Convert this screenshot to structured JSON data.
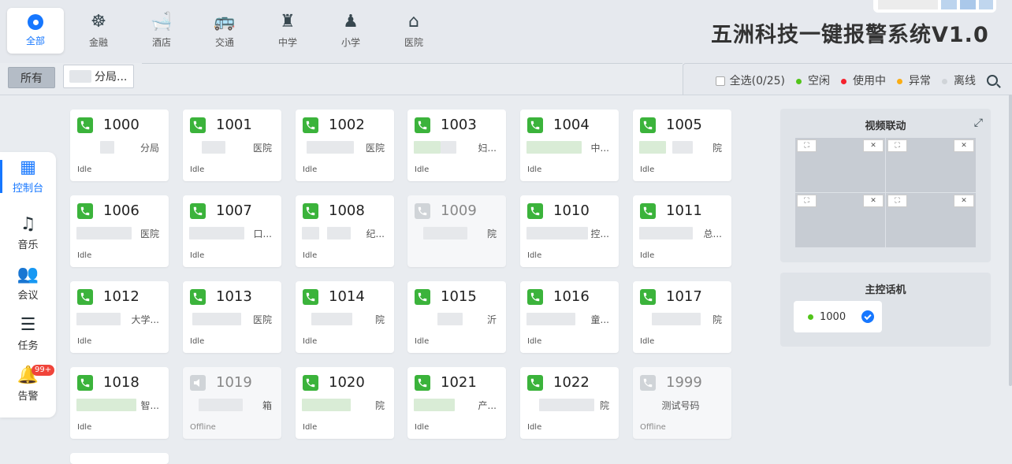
{
  "title": "五洲科技一键报警系统V1.0",
  "categories": [
    {
      "label": "全部",
      "icon": "radio-dot-icon",
      "active": true
    },
    {
      "label": "金融",
      "icon": "helm-wheel-icon"
    },
    {
      "label": "酒店",
      "icon": "bathtub-icon"
    },
    {
      "label": "交通",
      "icon": "bus-icon"
    },
    {
      "label": "中学",
      "icon": "student-icon"
    },
    {
      "label": "小学",
      "icon": "pupil-icon"
    },
    {
      "label": "医院",
      "icon": "hospital-house-icon"
    }
  ],
  "tabs": {
    "all": "所有",
    "branch": "分局..."
  },
  "legend": {
    "select_all": "全选(0/25)",
    "idle": "空闲",
    "busy": "使用中",
    "abnormal": "异常",
    "offline": "离线",
    "colors": {
      "idle": "#52c41a",
      "busy": "#f5222d",
      "abnormal": "#faad14",
      "offline": "#d0d4d8"
    }
  },
  "sidebar": [
    {
      "label": "控制台",
      "icon": "grid-icon",
      "active": true
    },
    {
      "label": "音乐",
      "icon": "music-note-icon"
    },
    {
      "label": "会议",
      "icon": "people-group-icon"
    },
    {
      "label": "任务",
      "icon": "task-list-icon"
    },
    {
      "label": "告警",
      "icon": "bell-icon",
      "badge": "99+"
    }
  ],
  "devices": [
    {
      "number": "1000",
      "name": "分局",
      "status": "Idle"
    },
    {
      "number": "1001",
      "name": "医院",
      "status": "Idle"
    },
    {
      "number": "1002",
      "name": "医院",
      "status": "Idle"
    },
    {
      "number": "1003",
      "name": "妇...",
      "status": "Idle"
    },
    {
      "number": "1004",
      "name": "中...",
      "status": "Idle"
    },
    {
      "number": "1005",
      "name": "院",
      "status": "Idle"
    },
    {
      "number": "1006",
      "name": "医院",
      "status": "Idle"
    },
    {
      "number": "1007",
      "name": "口...",
      "status": "Idle"
    },
    {
      "number": "1008",
      "name": "纪...",
      "status": "Idle"
    },
    {
      "number": "1009",
      "name": "院",
      "status": ""
    },
    {
      "number": "1010",
      "name": "控...",
      "status": "Idle"
    },
    {
      "number": "1011",
      "name": "总...",
      "status": "Idle"
    },
    {
      "number": "1012",
      "name": "大学...",
      "status": "Idle"
    },
    {
      "number": "1013",
      "name": "医院",
      "status": "Idle"
    },
    {
      "number": "1014",
      "name": "院",
      "status": "Idle"
    },
    {
      "number": "1015",
      "name": "沂",
      "status": "Idle"
    },
    {
      "number": "1016",
      "name": "童...",
      "status": "Idle"
    },
    {
      "number": "1017",
      "name": "院",
      "status": "Idle"
    },
    {
      "number": "1018",
      "name": "智...",
      "status": "Idle"
    },
    {
      "number": "1019",
      "name": "箱",
      "status": "Offline"
    },
    {
      "number": "1020",
      "name": "院",
      "status": "Idle"
    },
    {
      "number": "1021",
      "name": "产...",
      "status": "Idle"
    },
    {
      "number": "1022",
      "name": "院",
      "status": "Idle"
    },
    {
      "number": "1999",
      "name": "测试号码",
      "status": "Offline"
    }
  ],
  "video_panel": {
    "title": "视频联动",
    "expand_icon": "expand-arrows-icon"
  },
  "master_panel": {
    "title": "主控话机",
    "number": "1000"
  }
}
